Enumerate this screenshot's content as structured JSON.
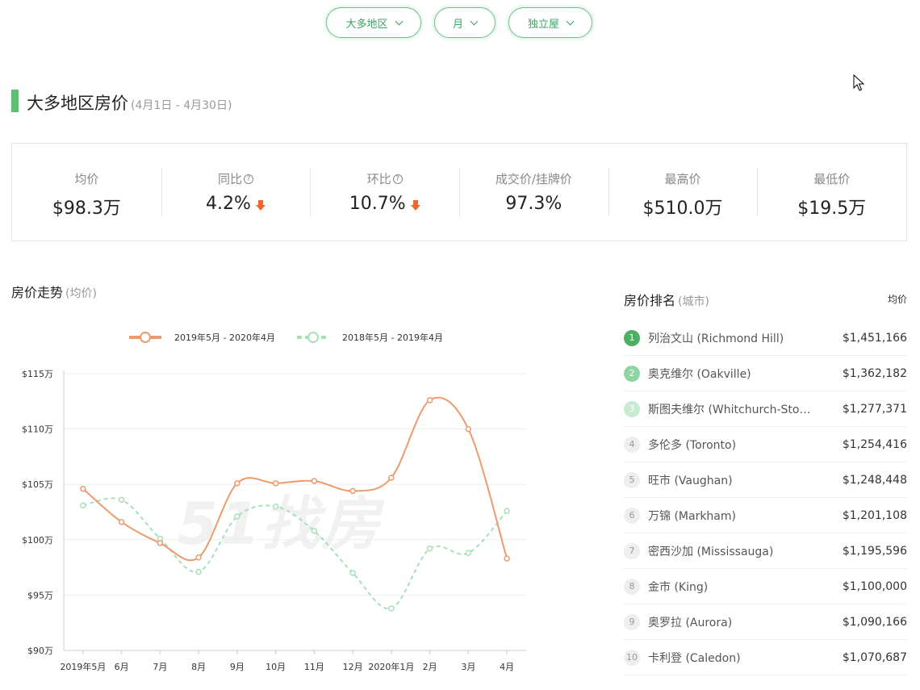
{
  "filters": [
    {
      "label": "大多地区"
    },
    {
      "label": "月"
    },
    {
      "label": "独立屋"
    }
  ],
  "header": {
    "title": "大多地区房价",
    "date_range": "(4月1日 - 4月30日)"
  },
  "stats": [
    {
      "label": "均价",
      "value": "$98.3万",
      "help": false,
      "arrow": false
    },
    {
      "label": "同比",
      "value": "4.2%",
      "help": true,
      "arrow": true
    },
    {
      "label": "环比",
      "value": "10.7%",
      "help": true,
      "arrow": true
    },
    {
      "label": "成交价/挂牌价",
      "value": "97.3%",
      "help": false,
      "arrow": false
    },
    {
      "label": "最高价",
      "value": "$510.0万",
      "help": false,
      "arrow": false
    },
    {
      "label": "最低价",
      "value": "$19.5万",
      "help": false,
      "arrow": false
    }
  ],
  "trend": {
    "title": "房价走势",
    "subtitle": "(均价)",
    "watermark": "51找房"
  },
  "colors": {
    "accent": "#5cbf73",
    "series1": "#ee9a6d",
    "series2": "#a8dfb8",
    "down": "#f0652d"
  },
  "chart_data": {
    "type": "line",
    "categories": [
      "2019年5月",
      "6月",
      "7月",
      "8月",
      "9月",
      "10月",
      "11月",
      "12月",
      "2020年1月",
      "2月",
      "3月",
      "4月"
    ],
    "series": [
      {
        "name": "2019年5月 - 2020年4月",
        "style": "solid",
        "values": [
          104.6,
          101.6,
          99.7,
          98.4,
          105.1,
          105.1,
          105.3,
          104.4,
          105.6,
          112.6,
          110.0,
          98.3
        ]
      },
      {
        "name": "2018年5月 - 2019年4月",
        "style": "dashed",
        "values": [
          103.1,
          103.6,
          100.1,
          97.1,
          102.1,
          103.0,
          100.8,
          97.0,
          93.8,
          99.2,
          98.8,
          102.6
        ]
      }
    ],
    "yticks": [
      "$90万",
      "$95万",
      "$100万",
      "$105万",
      "$110万",
      "$115万"
    ],
    "ylim": [
      90,
      115
    ],
    "legend": "top-center",
    "grid": true
  },
  "ranking": {
    "title": "房价排名",
    "subtitle": "(城市)",
    "column": "均价",
    "items": [
      {
        "rank": "1",
        "name": "列治文山 (Richmond Hill)",
        "price": "$1,451,166"
      },
      {
        "rank": "2",
        "name": "奥克维尔 (Oakville)",
        "price": "$1,362,182"
      },
      {
        "rank": "3",
        "name": "斯图夫维尔 (Whitchurch-Sto…",
        "price": "$1,277,371"
      },
      {
        "rank": "4",
        "name": "多伦多 (Toronto)",
        "price": "$1,254,416"
      },
      {
        "rank": "5",
        "name": "旺市 (Vaughan)",
        "price": "$1,248,448"
      },
      {
        "rank": "6",
        "name": "万锦 (Markham)",
        "price": "$1,201,108"
      },
      {
        "rank": "7",
        "name": "密西沙加 (Mississauga)",
        "price": "$1,195,596"
      },
      {
        "rank": "8",
        "name": "金市 (King)",
        "price": "$1,100,000"
      },
      {
        "rank": "9",
        "name": "奥罗拉 (Aurora)",
        "price": "$1,090,166"
      },
      {
        "rank": "10",
        "name": "卡利登 (Caledon)",
        "price": "$1,070,687"
      }
    ]
  }
}
